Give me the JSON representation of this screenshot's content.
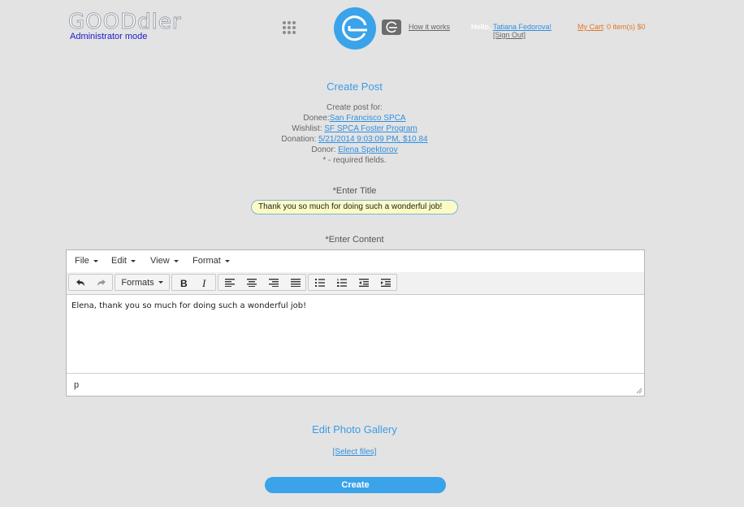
{
  "header": {
    "logo_text": "GOODdler",
    "mode": "Administrator mode",
    "how_it_works": "How it works",
    "hello": "Hello,",
    "user_name": "Tatiana Fedorova!",
    "sign_out": "[Sign Out]",
    "cart_link": "My Cart",
    "cart_info": ": 0 item(s) $0",
    "colors": {
      "accent": "#3aa3ea",
      "cart": "#e0782a",
      "admin": "#1a1acc"
    }
  },
  "page": {
    "title": "Create Post",
    "create_for": "Create post for:",
    "donee_label": "Donee:",
    "donee_value": "San Francisco SPCA",
    "wishlist_label": "Wishlist:",
    "wishlist_value": "SF SPCA Foster Program",
    "donation_label": "Donation:",
    "donation_value": "5/21/2014 9:03:09 PM, $10.84",
    "donor_label": "Donor:",
    "donor_value": "Elena Spektorov",
    "required_note": "* - required fields.",
    "enter_title_label": "*Enter Title",
    "title_value": "Thank you so much for doing such a wonderful job!",
    "enter_content_label": "*Enter Content"
  },
  "editor": {
    "menu": [
      "File",
      "Edit",
      "View",
      "Format"
    ],
    "formats_label": "Formats",
    "content": "Elena, thank you so much for doing such a wonderful job!",
    "path": "p"
  },
  "gallery": {
    "title": "Edit Photo Gallery",
    "select_files": "[Select files]"
  },
  "actions": {
    "create": "Create"
  }
}
